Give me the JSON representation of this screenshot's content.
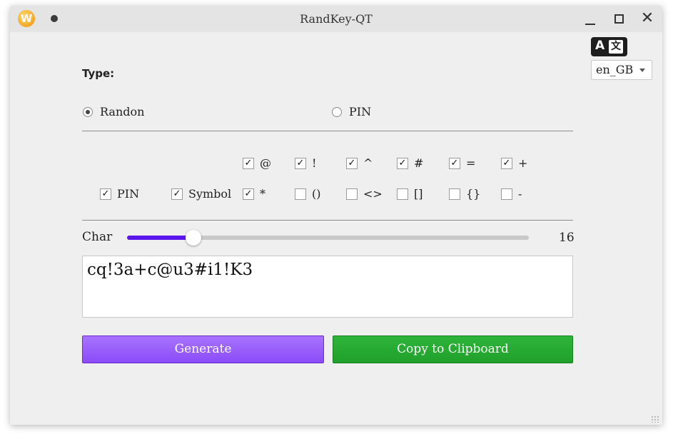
{
  "window": {
    "title": "RandKey-QT",
    "app_icon_letter": "W"
  },
  "language": {
    "icon": "translate-icon",
    "icon_left": "A",
    "icon_right": "文",
    "selected": "en_GB"
  },
  "type_section": {
    "label": "Type:",
    "options": [
      {
        "label": "Randon",
        "selected": true
      },
      {
        "label": "PIN",
        "selected": false
      }
    ]
  },
  "options": {
    "pin": {
      "label": "PIN",
      "checked": true
    },
    "symbol": {
      "label": "Symbol",
      "checked": true
    },
    "symbols": [
      {
        "label": "@",
        "checked": true
      },
      {
        "label": "!",
        "checked": true
      },
      {
        "label": "^",
        "checked": true
      },
      {
        "label": "#",
        "checked": true
      },
      {
        "label": "=",
        "checked": true
      },
      {
        "label": "+",
        "checked": true
      },
      {
        "label": "*",
        "checked": true
      },
      {
        "label": "()",
        "checked": false
      },
      {
        "label": "<>",
        "checked": false
      },
      {
        "label": "[]",
        "checked": false
      },
      {
        "label": "{}",
        "checked": false
      },
      {
        "label": "-",
        "checked": false
      }
    ]
  },
  "length": {
    "label": "Char",
    "value": "16",
    "fraction": 0.166
  },
  "output": {
    "password": "cq!3a+c@u3#i1!K3"
  },
  "buttons": {
    "generate": "Generate",
    "copy": "Copy to Clipboard"
  },
  "colors": {
    "accent": "#5b16ee",
    "generate": "#9a5cf9",
    "copy": "#27a833"
  }
}
